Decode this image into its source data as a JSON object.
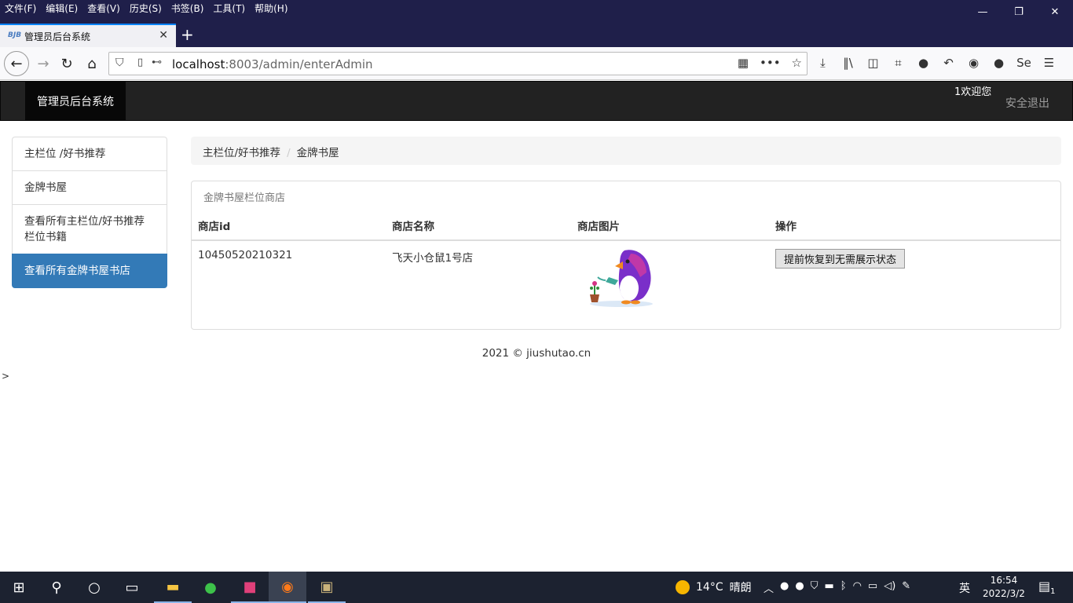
{
  "browser": {
    "menu": [
      "文件(F)",
      "编辑(E)",
      "查看(V)",
      "历史(S)",
      "书签(B)",
      "工具(T)",
      "帮助(H)"
    ],
    "tab_title": "管理员后台系统",
    "tab_favicon": "BJB",
    "url_host": "localhost",
    "url_rest": ":8003/admin/enterAdmin",
    "toolbar_icons": [
      "download-icon",
      "library-icon",
      "sidebar-icon",
      "crop-icon",
      "chat-icon",
      "undo-icon",
      "account-icon",
      "extension-icon",
      "selenium-icon",
      "menu-icon"
    ]
  },
  "app": {
    "brand": "管理员后台系统",
    "welcome": "1欢迎您",
    "logout": "安全退出"
  },
  "sidebar": {
    "items": [
      {
        "label": "主栏位 /好书推荐",
        "active": false
      },
      {
        "label": "金牌书屋",
        "active": false
      },
      {
        "label": "查看所有主栏位/好书推荐栏位书籍",
        "active": false
      },
      {
        "label": "查看所有金牌书屋书店",
        "active": true
      }
    ]
  },
  "breadcrumb": {
    "first": "主栏位/好书推荐",
    "separator": "/",
    "second": "金牌书屋"
  },
  "panel": {
    "title": "金牌书屋栏位商店",
    "columns": [
      "商店id",
      "商店名称",
      "商店图片",
      "操作"
    ],
    "rows": [
      {
        "id": "10450520210321",
        "name": "飞天小仓鼠1号店",
        "image": "penguin-watering-plant",
        "action": "提前恢复到无需展示状态"
      }
    ]
  },
  "footer": "2021 © jiushutao.cn",
  "stray_text": ">",
  "taskbar": {
    "weather_temp": "14°C",
    "weather_desc": "晴朗",
    "ime": "英",
    "time": "16:54",
    "date": "2022/3/2",
    "notifications": "1"
  },
  "colors": {
    "browser_frame": "#1f1f4a",
    "nav_dark": "#222222",
    "active_blue": "#337ab7",
    "taskbar": "#1c2230"
  }
}
